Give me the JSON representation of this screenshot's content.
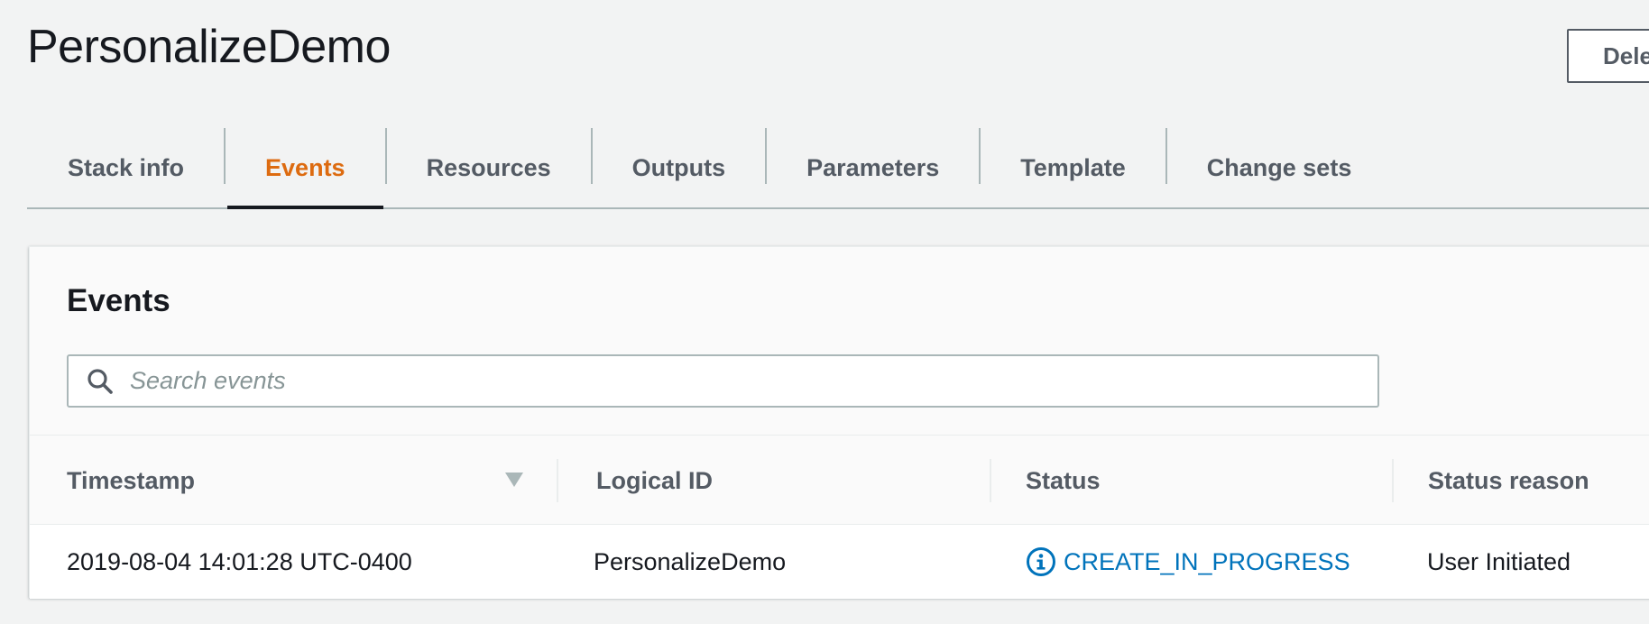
{
  "header": {
    "title": "PersonalizeDemo",
    "delete_label": "Delete"
  },
  "tabs": [
    {
      "label": "Stack info",
      "active": false
    },
    {
      "label": "Events",
      "active": true
    },
    {
      "label": "Resources",
      "active": false
    },
    {
      "label": "Outputs",
      "active": false
    },
    {
      "label": "Parameters",
      "active": false
    },
    {
      "label": "Template",
      "active": false
    },
    {
      "label": "Change sets",
      "active": false
    }
  ],
  "events": {
    "title": "Events",
    "search_placeholder": "Search events",
    "search_value": "",
    "columns": [
      "Timestamp",
      "Logical ID",
      "Status",
      "Status reason"
    ],
    "rows": [
      {
        "timestamp": "2019-08-04 14:01:28 UTC-0400",
        "logical_id": "PersonalizeDemo",
        "status": "CREATE_IN_PROGRESS",
        "status_reason": "User Initiated"
      }
    ]
  },
  "colors": {
    "accent": "#dd6b10",
    "link": "#0073bb",
    "background": "#f2f3f3"
  },
  "icons": {
    "search": "search-icon",
    "sort": "sort-descending-icon",
    "status": "info-icon"
  }
}
